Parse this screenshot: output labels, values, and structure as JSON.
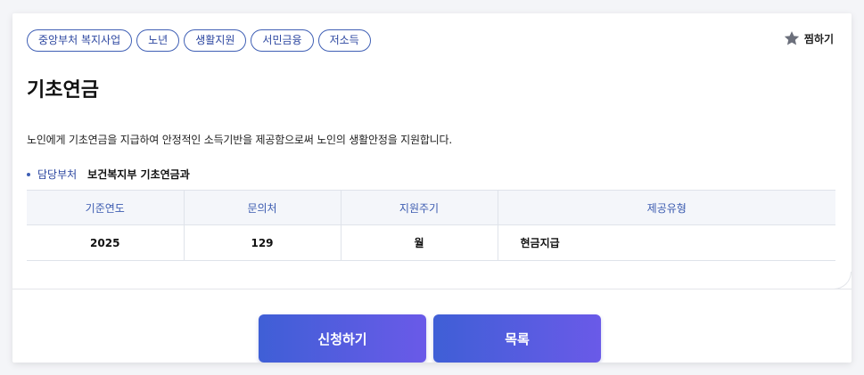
{
  "tags": [
    "중앙부처 복지사업",
    "노년",
    "생활지원",
    "서민금융",
    "저소득"
  ],
  "favorite": {
    "label": "찜하기",
    "icon": "star-icon"
  },
  "title": "기초연금",
  "description": "노인에게 기초연금을 지급하여 안정적인 소득기반을 제공함으로써 노인의 생활안정을 지원합니다.",
  "department": {
    "label": "담당부처",
    "value": "보건복지부 기초연금과"
  },
  "table": {
    "headers": [
      "기준연도",
      "문의처",
      "지원주기",
      "제공유형"
    ],
    "row": [
      "2025",
      "129",
      "월",
      "현금지급"
    ]
  },
  "buttons": {
    "apply": "신청하기",
    "list": "목록"
  },
  "colors": {
    "accent": "#3f5fb5",
    "button_start": "#3f5fd6",
    "button_end": "#6a5ae8"
  }
}
